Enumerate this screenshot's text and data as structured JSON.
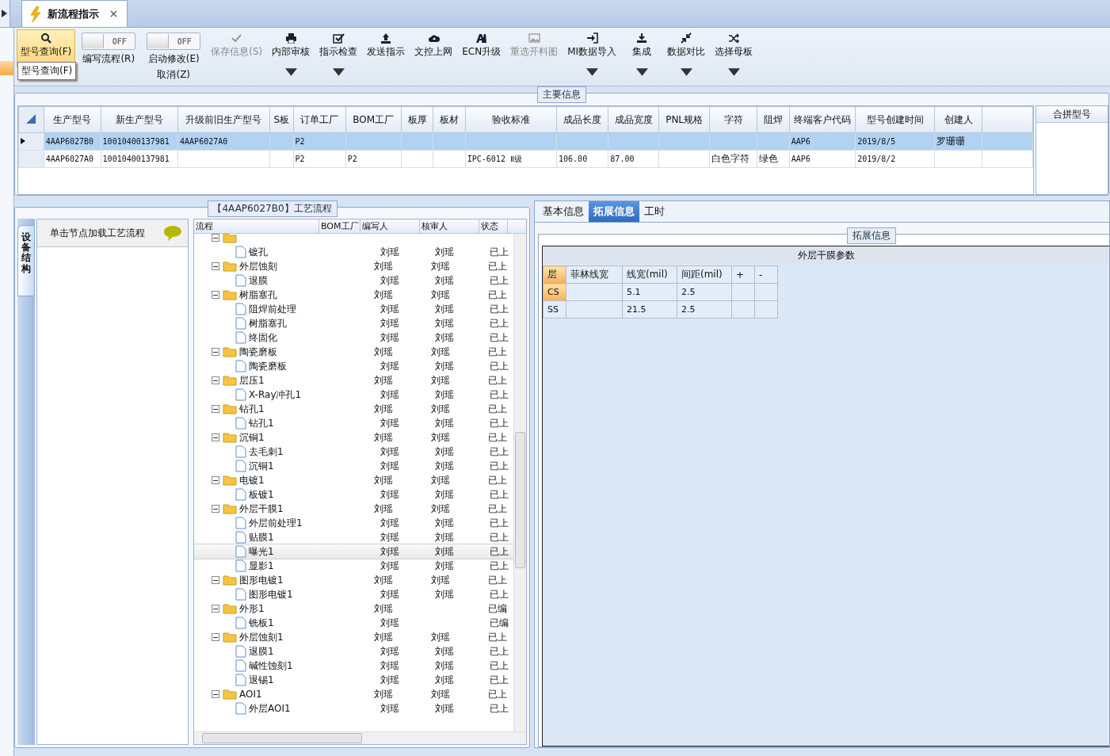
{
  "doc_tab": {
    "title": "新流程指示",
    "selected": true
  },
  "toolbar": [
    {
      "kind": "button",
      "label": "型号查询(F)",
      "selected": true,
      "disabled": false,
      "dropdown": false
    },
    {
      "kind": "toggle",
      "toggle_text": "OFF",
      "on": false,
      "label": "编写流程(R)"
    },
    {
      "kind": "toggle",
      "toggle_text": "OFF",
      "on": false,
      "label": "启动修改(E)",
      "label2": "取消(Z)"
    },
    {
      "kind": "button",
      "label": "保存信息(S)",
      "selected": false,
      "disabled": true,
      "dropdown": false
    },
    {
      "kind": "button",
      "label": "内部审核",
      "selected": false,
      "disabled": false,
      "dropdown": true
    },
    {
      "kind": "button",
      "label": "指示检查",
      "selected": false,
      "disabled": false,
      "dropdown": true
    },
    {
      "kind": "button",
      "label": "发送指示",
      "selected": false,
      "disabled": false,
      "dropdown": false
    },
    {
      "kind": "button",
      "label": "文控上网",
      "selected": false,
      "disabled": false,
      "dropdown": false
    },
    {
      "kind": "button",
      "label": "ECN升级",
      "selected": false,
      "disabled": false,
      "dropdown": false
    },
    {
      "kind": "button",
      "label": "重选开料图",
      "selected": false,
      "disabled": true,
      "dropdown": false
    },
    {
      "kind": "button",
      "label": "MI数据导入",
      "selected": false,
      "disabled": false,
      "dropdown": true
    },
    {
      "kind": "button",
      "label": "集成",
      "selected": false,
      "disabled": false,
      "dropdown": true
    },
    {
      "kind": "button",
      "label": "数据对比",
      "selected": false,
      "disabled": false,
      "dropdown": true
    },
    {
      "kind": "button",
      "label": "选择母板",
      "selected": false,
      "disabled": false,
      "dropdown": true
    }
  ],
  "tooltip": "型号查询(F)",
  "main_info": {
    "legend": "主要信息",
    "columns": [
      "生产型号",
      "新生产型号",
      "升级前旧生产型号",
      "S板",
      "订单工厂",
      "BOM工厂",
      "板厚",
      "板材",
      "验收标准",
      "成品长度",
      "成品宽度",
      "PNL规格",
      "字符",
      "阻焊",
      "终端客户代码",
      "型号创建时间",
      "创建人"
    ],
    "rows": [
      {
        "selected": true,
        "cells": [
          "4AAP6027B0",
          "10010400137981",
          "4AAP6027A0",
          "",
          "P2",
          "",
          "",
          "",
          "",
          "",
          "",
          "",
          "",
          "",
          "AAP6",
          "2019/8/5",
          "罗珊珊"
        ]
      },
      {
        "selected": false,
        "cells": [
          "4AAP6027A0",
          "10010400137981",
          "",
          "",
          "P2",
          "P2",
          "",
          "",
          "IPC-6012 Ⅱ级",
          "106.00",
          "87.00",
          "",
          "白色字符",
          "绿色",
          "AAP6",
          "2019/8/2",
          ""
        ]
      }
    ],
    "side_header": "合拼型号"
  },
  "process": {
    "legend": "【4AAP6027B0】工艺流程",
    "side_tab": "设备结构",
    "hint": "单击节点加载工艺流程",
    "columns": [
      "流程",
      "BOM工厂",
      "编写人",
      "核审人",
      "状态"
    ],
    "tree": [
      {
        "kind": "folder",
        "expanded": true,
        "children": [
          {
            "kind": "file",
            "label": "镀孔",
            "writer": "刘瑶",
            "reviewer": "刘瑶",
            "status": "已上",
            "selected": false
          }
        ]
      },
      {
        "kind": "folder",
        "label": "外层蚀刻",
        "writer": "刘瑶",
        "reviewer": "刘瑶",
        "status": "已上",
        "expanded": true,
        "selected": false,
        "children": [
          {
            "kind": "file",
            "label": "退膜",
            "writer": "刘瑶",
            "reviewer": "刘瑶",
            "status": "已上",
            "selected": false
          }
        ]
      },
      {
        "kind": "folder",
        "label": "树脂塞孔",
        "writer": "刘瑶",
        "reviewer": "刘瑶",
        "status": "已上",
        "expanded": true,
        "selected": false,
        "children": [
          {
            "kind": "file",
            "label": "阻焊前处理",
            "writer": "刘瑶",
            "reviewer": "刘瑶",
            "status": "已上",
            "selected": false
          },
          {
            "kind": "file",
            "label": "树脂塞孔",
            "writer": "刘瑶",
            "reviewer": "刘瑶",
            "status": "已上",
            "selected": false
          },
          {
            "kind": "file",
            "label": "终固化",
            "writer": "刘瑶",
            "reviewer": "刘瑶",
            "status": "已上",
            "selected": false
          }
        ]
      },
      {
        "kind": "folder",
        "label": "陶瓷磨板",
        "writer": "刘瑶",
        "reviewer": "刘瑶",
        "status": "已上",
        "expanded": true,
        "selected": false,
        "children": [
          {
            "kind": "file",
            "label": "陶瓷磨板",
            "writer": "刘瑶",
            "reviewer": "刘瑶",
            "status": "已上",
            "selected": false
          }
        ]
      },
      {
        "kind": "folder",
        "label": "层压1",
        "writer": "刘瑶",
        "reviewer": "刘瑶",
        "status": "已上",
        "expanded": true,
        "selected": false,
        "children": [
          {
            "kind": "file",
            "label": "X-Ray冲孔1",
            "writer": "刘瑶",
            "reviewer": "刘瑶",
            "status": "已上",
            "selected": false
          }
        ]
      },
      {
        "kind": "folder",
        "label": "钻孔1",
        "writer": "刘瑶",
        "reviewer": "刘瑶",
        "status": "已上",
        "expanded": true,
        "selected": false,
        "children": [
          {
            "kind": "file",
            "label": "钻孔1",
            "writer": "刘瑶",
            "reviewer": "刘瑶",
            "status": "已上",
            "selected": false
          }
        ]
      },
      {
        "kind": "folder",
        "label": "沉铜1",
        "writer": "刘瑶",
        "reviewer": "刘瑶",
        "status": "已上",
        "expanded": true,
        "selected": false,
        "children": [
          {
            "kind": "file",
            "label": "去毛刺1",
            "writer": "刘瑶",
            "reviewer": "刘瑶",
            "status": "已上",
            "selected": false
          },
          {
            "kind": "file",
            "label": "沉铜1",
            "writer": "刘瑶",
            "reviewer": "刘瑶",
            "status": "已上",
            "selected": false
          }
        ]
      },
      {
        "kind": "folder",
        "label": "电镀1",
        "writer": "刘瑶",
        "reviewer": "刘瑶",
        "status": "已上",
        "expanded": true,
        "selected": false,
        "children": [
          {
            "kind": "file",
            "label": "板镀1",
            "writer": "刘瑶",
            "reviewer": "刘瑶",
            "status": "已上",
            "selected": false
          }
        ]
      },
      {
        "kind": "folder",
        "label": "外层干膜1",
        "writer": "刘瑶",
        "reviewer": "刘瑶",
        "status": "已上",
        "expanded": true,
        "selected": false,
        "children": [
          {
            "kind": "file",
            "label": "外层前处理1",
            "writer": "刘瑶",
            "reviewer": "刘瑶",
            "status": "已上",
            "selected": false
          },
          {
            "kind": "file",
            "label": "贴膜1",
            "writer": "刘瑶",
            "reviewer": "刘瑶",
            "status": "已上",
            "selected": false
          },
          {
            "kind": "file",
            "label": "曝光1",
            "writer": "刘瑶",
            "reviewer": "刘瑶",
            "status": "已上",
            "selected": true
          },
          {
            "kind": "file",
            "label": "显影1",
            "writer": "刘瑶",
            "reviewer": "刘瑶",
            "status": "已上",
            "selected": false
          }
        ]
      },
      {
        "kind": "folder",
        "label": "图形电镀1",
        "writer": "刘瑶",
        "reviewer": "刘瑶",
        "status": "已上",
        "expanded": true,
        "selected": false,
        "children": [
          {
            "kind": "file",
            "label": "图形电镀1",
            "writer": "刘瑶",
            "reviewer": "刘瑶",
            "status": "已上",
            "selected": false
          }
        ]
      },
      {
        "kind": "folder",
        "label": "外形1",
        "writer": "刘瑶",
        "status": "已编",
        "expanded": true,
        "selected": false,
        "children": [
          {
            "kind": "file",
            "label": "铣板1",
            "writer": "刘瑶",
            "status": "已编",
            "selected": false
          }
        ]
      },
      {
        "kind": "folder",
        "label": "外层蚀刻1",
        "writer": "刘瑶",
        "reviewer": "刘瑶",
        "status": "已上",
        "expanded": true,
        "selected": false,
        "children": [
          {
            "kind": "file",
            "label": "退膜1",
            "writer": "刘瑶",
            "reviewer": "刘瑶",
            "status": "已上",
            "selected": false
          },
          {
            "kind": "file",
            "label": "碱性蚀刻1",
            "writer": "刘瑶",
            "reviewer": "刘瑶",
            "status": "已上",
            "selected": false
          },
          {
            "kind": "file",
            "label": "退锡1",
            "writer": "刘瑶",
            "reviewer": "刘瑶",
            "status": "已上",
            "selected": false
          }
        ]
      },
      {
        "kind": "folder",
        "label": "AOI1",
        "writer": "刘瑶",
        "reviewer": "刘瑶",
        "status": "已上",
        "expanded": true,
        "selected": false,
        "children": [
          {
            "kind": "file",
            "label": "外层AOI1",
            "writer": "刘瑶",
            "reviewer": "刘瑶",
            "status": "已上",
            "selected": false
          }
        ]
      }
    ]
  },
  "detail": {
    "tabs": [
      {
        "label": "基本信息",
        "selected": false
      },
      {
        "label": "拓展信息",
        "selected": true
      },
      {
        "label": "工时",
        "selected": false
      }
    ],
    "legend": "拓展信息",
    "table_title": "外层干膜参数",
    "columns": [
      "层",
      "菲林线宽",
      "线宽(mil)",
      "间距(mil)",
      "+",
      "-"
    ],
    "rows": [
      {
        "selected": true,
        "cells": [
          "CS",
          "",
          "5.1",
          "2.5",
          "",
          ""
        ]
      },
      {
        "selected": false,
        "cells": [
          "SS",
          "",
          "21.5",
          "2.5",
          "",
          ""
        ]
      }
    ]
  }
}
